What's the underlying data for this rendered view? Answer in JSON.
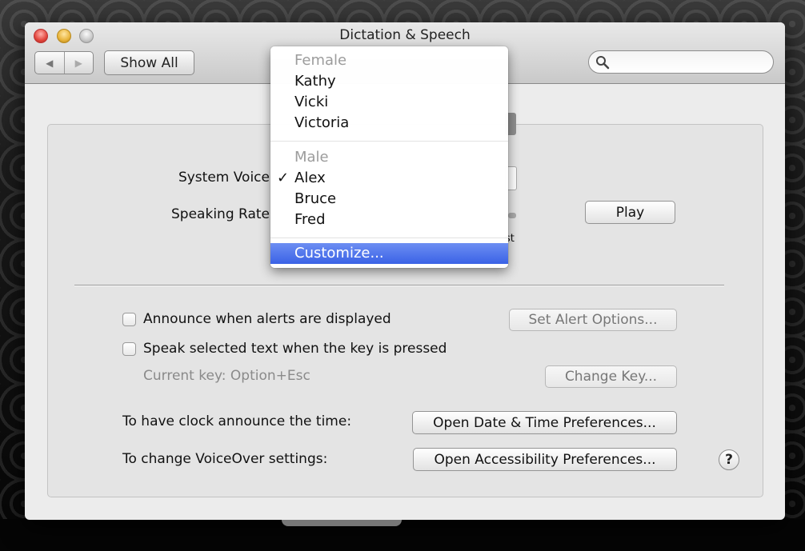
{
  "window": {
    "title": "Dictation & Speech",
    "traffic_lights": [
      "close",
      "minimize",
      "zoom"
    ]
  },
  "toolbar": {
    "back_icon": "back-arrow-icon",
    "forward_icon": "forward-arrow-icon",
    "back_glyph": "◀",
    "forward_glyph": "▶",
    "show_all_label": "Show All",
    "search_placeholder": "",
    "search_value": ""
  },
  "speech": {
    "system_voice_label": "System Voice",
    "speaking_rate_label": "Speaking Rate",
    "play_label": "Play",
    "rate_fast_label_partial": "st"
  },
  "voice_menu": {
    "groups": [
      {
        "header": "Female",
        "items": [
          "Kathy",
          "Vicki",
          "Victoria"
        ]
      },
      {
        "header": "Male",
        "items": [
          "Alex",
          "Bruce",
          "Fred"
        ]
      }
    ],
    "selected": "Alex",
    "check_glyph": "✓",
    "customize_label": "Customize...",
    "highlighted": "Customize..."
  },
  "options": {
    "announce_alerts_label": "Announce when alerts are displayed",
    "announce_alerts_checked": false,
    "set_alert_options_label": "Set Alert Options...",
    "speak_selected_label": "Speak selected text when the key is pressed",
    "speak_selected_checked": false,
    "current_key_label": "Current key: Option+Esc",
    "change_key_label": "Change Key..."
  },
  "links": {
    "clock_label": "To have clock announce the time:",
    "clock_button": "Open Date & Time Preferences...",
    "voiceover_label": "To change VoiceOver settings:",
    "voiceover_button": "Open Accessibility Preferences...",
    "help_glyph": "?"
  },
  "colors": {
    "menu_highlight": "#3a62e6",
    "window_bg": "#ececec",
    "group_bg": "#e4e4e4"
  }
}
